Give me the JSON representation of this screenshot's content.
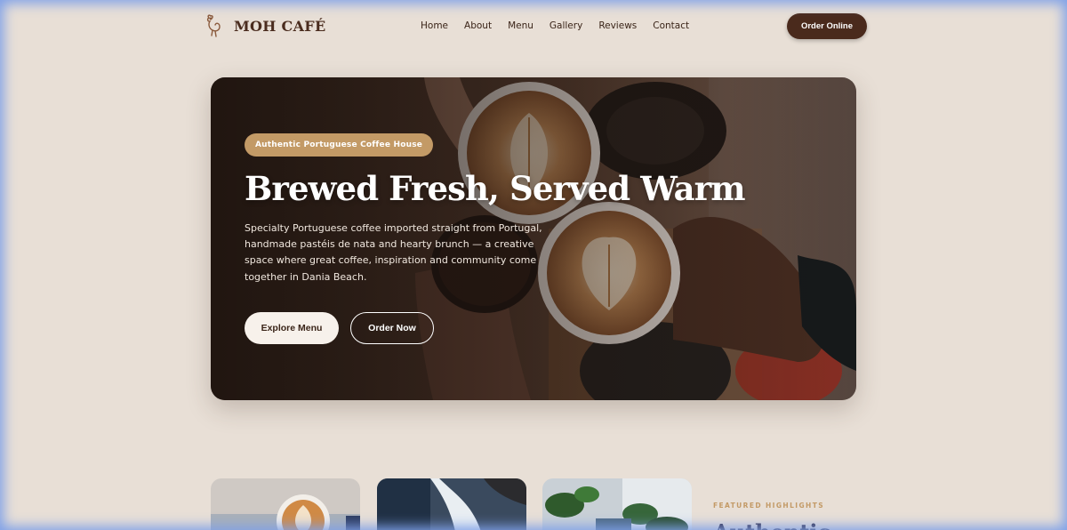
{
  "brand": {
    "name": "MOH CAFÉ"
  },
  "nav": {
    "items": [
      "Home",
      "About",
      "Menu",
      "Gallery",
      "Reviews",
      "Contact"
    ],
    "cta_label": "Order Online"
  },
  "hero": {
    "badge": "Authentic Portuguese Coffee House",
    "title": "Brewed Fresh, Served Warm",
    "description": "Specialty Portuguese coffee imported straight from Portugal, handmade pastéis de nata and hearty brunch — a creative space where great coffee, inspiration and community come together in Dania Beach.",
    "primary_button": "Explore Menu",
    "secondary_button": "Order Now"
  },
  "highlights": {
    "label": "FEATURED HIGHLIGHTS",
    "title": "Authentic"
  },
  "colors": {
    "background": "#e8dfd6",
    "brand_dark": "#4a2a1c",
    "accent": "#c39a66"
  }
}
